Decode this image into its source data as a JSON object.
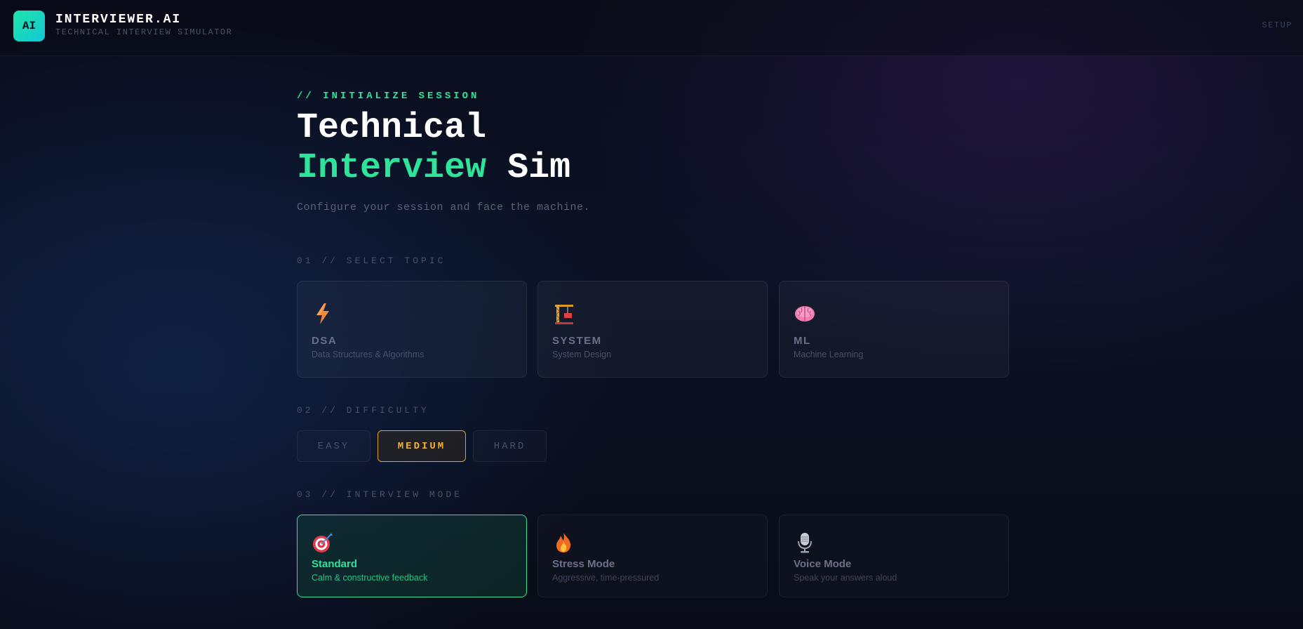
{
  "header": {
    "logo_text": "AI",
    "brand_title": "INTERVIEWER.AI",
    "brand_subtitle": "TECHNICAL INTERVIEW SIMULATOR",
    "nav_label": "SETUP"
  },
  "hero": {
    "kicker": "// INITIALIZE SESSION",
    "line1": "Technical",
    "line2_accent": "Interview",
    "line2_rest": "Sim",
    "tagline": "Configure your session and face the machine."
  },
  "topic_section": {
    "label": "01 // SELECT TOPIC",
    "cards": [
      {
        "icon": "lightning-icon",
        "title": "DSA",
        "desc": "Data Structures & Algorithms"
      },
      {
        "icon": "crane-icon",
        "title": "SYSTEM",
        "desc": "System Design"
      },
      {
        "icon": "brain-icon",
        "title": "ML",
        "desc": "Machine Learning"
      }
    ]
  },
  "difficulty_section": {
    "label": "02 // DIFFICULTY",
    "options": [
      "EASY",
      "MEDIUM",
      "HARD"
    ],
    "selected": "MEDIUM"
  },
  "mode_section": {
    "label": "03 // INTERVIEW MODE",
    "selected": "Standard",
    "cards": [
      {
        "icon": "target-icon",
        "title": "Standard",
        "desc": "Calm & constructive feedback"
      },
      {
        "icon": "fire-icon",
        "title": "Stress Mode",
        "desc": "Aggressive, time-pressured"
      },
      {
        "icon": "microphone-icon",
        "title": "Voice Mode",
        "desc": "Speak your answers aloud"
      }
    ]
  },
  "colors": {
    "accent_green": "#2fe39a",
    "accent_amber": "#f2b22e",
    "background": "#0b1224"
  }
}
